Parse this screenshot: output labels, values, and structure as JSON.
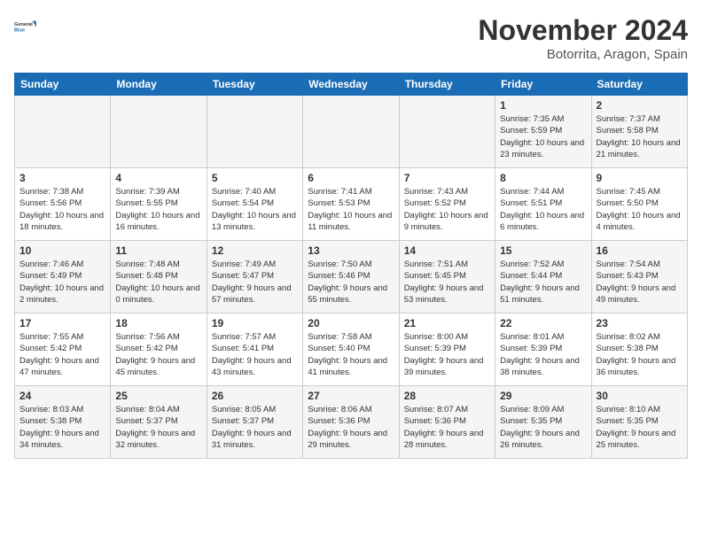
{
  "logo": {
    "line1": "General",
    "line2": "Blue"
  },
  "title": "November 2024",
  "location": "Botorrita, Aragon, Spain",
  "days_of_week": [
    "Sunday",
    "Monday",
    "Tuesday",
    "Wednesday",
    "Thursday",
    "Friday",
    "Saturday"
  ],
  "weeks": [
    [
      {
        "day": "",
        "text": ""
      },
      {
        "day": "",
        "text": ""
      },
      {
        "day": "",
        "text": ""
      },
      {
        "day": "",
        "text": ""
      },
      {
        "day": "",
        "text": ""
      },
      {
        "day": "1",
        "text": "Sunrise: 7:35 AM\nSunset: 5:59 PM\nDaylight: 10 hours and 23 minutes."
      },
      {
        "day": "2",
        "text": "Sunrise: 7:37 AM\nSunset: 5:58 PM\nDaylight: 10 hours and 21 minutes."
      }
    ],
    [
      {
        "day": "3",
        "text": "Sunrise: 7:38 AM\nSunset: 5:56 PM\nDaylight: 10 hours and 18 minutes."
      },
      {
        "day": "4",
        "text": "Sunrise: 7:39 AM\nSunset: 5:55 PM\nDaylight: 10 hours and 16 minutes."
      },
      {
        "day": "5",
        "text": "Sunrise: 7:40 AM\nSunset: 5:54 PM\nDaylight: 10 hours and 13 minutes."
      },
      {
        "day": "6",
        "text": "Sunrise: 7:41 AM\nSunset: 5:53 PM\nDaylight: 10 hours and 11 minutes."
      },
      {
        "day": "7",
        "text": "Sunrise: 7:43 AM\nSunset: 5:52 PM\nDaylight: 10 hours and 9 minutes."
      },
      {
        "day": "8",
        "text": "Sunrise: 7:44 AM\nSunset: 5:51 PM\nDaylight: 10 hours and 6 minutes."
      },
      {
        "day": "9",
        "text": "Sunrise: 7:45 AM\nSunset: 5:50 PM\nDaylight: 10 hours and 4 minutes."
      }
    ],
    [
      {
        "day": "10",
        "text": "Sunrise: 7:46 AM\nSunset: 5:49 PM\nDaylight: 10 hours and 2 minutes."
      },
      {
        "day": "11",
        "text": "Sunrise: 7:48 AM\nSunset: 5:48 PM\nDaylight: 10 hours and 0 minutes."
      },
      {
        "day": "12",
        "text": "Sunrise: 7:49 AM\nSunset: 5:47 PM\nDaylight: 9 hours and 57 minutes."
      },
      {
        "day": "13",
        "text": "Sunrise: 7:50 AM\nSunset: 5:46 PM\nDaylight: 9 hours and 55 minutes."
      },
      {
        "day": "14",
        "text": "Sunrise: 7:51 AM\nSunset: 5:45 PM\nDaylight: 9 hours and 53 minutes."
      },
      {
        "day": "15",
        "text": "Sunrise: 7:52 AM\nSunset: 5:44 PM\nDaylight: 9 hours and 51 minutes."
      },
      {
        "day": "16",
        "text": "Sunrise: 7:54 AM\nSunset: 5:43 PM\nDaylight: 9 hours and 49 minutes."
      }
    ],
    [
      {
        "day": "17",
        "text": "Sunrise: 7:55 AM\nSunset: 5:42 PM\nDaylight: 9 hours and 47 minutes."
      },
      {
        "day": "18",
        "text": "Sunrise: 7:56 AM\nSunset: 5:42 PM\nDaylight: 9 hours and 45 minutes."
      },
      {
        "day": "19",
        "text": "Sunrise: 7:57 AM\nSunset: 5:41 PM\nDaylight: 9 hours and 43 minutes."
      },
      {
        "day": "20",
        "text": "Sunrise: 7:58 AM\nSunset: 5:40 PM\nDaylight: 9 hours and 41 minutes."
      },
      {
        "day": "21",
        "text": "Sunrise: 8:00 AM\nSunset: 5:39 PM\nDaylight: 9 hours and 39 minutes."
      },
      {
        "day": "22",
        "text": "Sunrise: 8:01 AM\nSunset: 5:39 PM\nDaylight: 9 hours and 38 minutes."
      },
      {
        "day": "23",
        "text": "Sunrise: 8:02 AM\nSunset: 5:38 PM\nDaylight: 9 hours and 36 minutes."
      }
    ],
    [
      {
        "day": "24",
        "text": "Sunrise: 8:03 AM\nSunset: 5:38 PM\nDaylight: 9 hours and 34 minutes."
      },
      {
        "day": "25",
        "text": "Sunrise: 8:04 AM\nSunset: 5:37 PM\nDaylight: 9 hours and 32 minutes."
      },
      {
        "day": "26",
        "text": "Sunrise: 8:05 AM\nSunset: 5:37 PM\nDaylight: 9 hours and 31 minutes."
      },
      {
        "day": "27",
        "text": "Sunrise: 8:06 AM\nSunset: 5:36 PM\nDaylight: 9 hours and 29 minutes."
      },
      {
        "day": "28",
        "text": "Sunrise: 8:07 AM\nSunset: 5:36 PM\nDaylight: 9 hours and 28 minutes."
      },
      {
        "day": "29",
        "text": "Sunrise: 8:09 AM\nSunset: 5:35 PM\nDaylight: 9 hours and 26 minutes."
      },
      {
        "day": "30",
        "text": "Sunrise: 8:10 AM\nSunset: 5:35 PM\nDaylight: 9 hours and 25 minutes."
      }
    ]
  ]
}
